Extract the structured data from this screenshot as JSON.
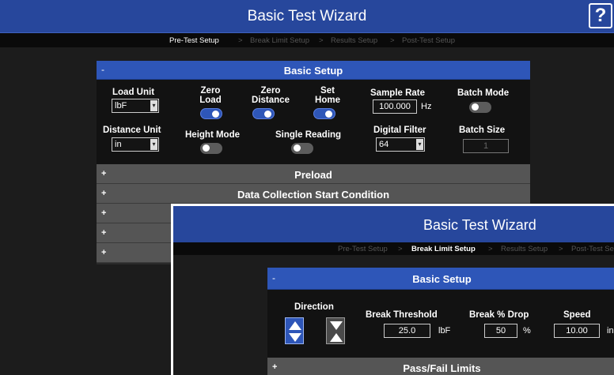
{
  "back_window": {
    "title": "Basic Test Wizard",
    "help_label": "?",
    "breadcrumbs": [
      "Pre-Test Setup",
      "Break Limit Setup",
      "Results Setup",
      "Post-Test Setup"
    ],
    "separator": ">",
    "basic_setup": {
      "toggle": "-",
      "title": "Basic Setup",
      "load_unit_label": "Load Unit",
      "load_unit_value": "lbF",
      "distance_unit_label": "Distance Unit",
      "distance_unit_value": "in",
      "zero_load_label": "Zero\nLoad",
      "zero_load_on": true,
      "zero_distance_label": "Zero\nDistance",
      "zero_distance_on": true,
      "set_home_label": "Set\nHome",
      "set_home_on": true,
      "height_mode_label": "Height Mode",
      "height_mode_on": false,
      "single_reading_label": "Single Reading",
      "single_reading_on": false,
      "sample_rate_label": "Sample Rate",
      "sample_rate_value": "100.000",
      "sample_rate_unit": "Hz",
      "digital_filter_label": "Digital Filter",
      "digital_filter_value": "64",
      "batch_mode_label": "Batch Mode",
      "batch_mode_on": false,
      "batch_size_label": "Batch Size",
      "batch_size_value": "1"
    },
    "collapsed_sections": [
      {
        "toggle": "+",
        "label": "Preload"
      },
      {
        "toggle": "+",
        "label": "Data Collection Start Condition"
      },
      {
        "toggle": "+",
        "label": ""
      },
      {
        "toggle": "+",
        "label": ""
      },
      {
        "toggle": "+",
        "label": ""
      }
    ]
  },
  "front_window": {
    "title": "Basic Test Wizard",
    "breadcrumbs": [
      "Pre-Test Setup",
      "Break Limit Setup",
      "Results Setup",
      "Post-Test Se"
    ],
    "separator": ">",
    "basic_setup": {
      "toggle": "-",
      "title": "Basic Setup",
      "direction_label": "Direction",
      "break_threshold_label": "Break Threshold",
      "break_threshold_value": "25.0",
      "break_threshold_unit": "lbF",
      "break_drop_label": "Break % Drop",
      "break_drop_value": "50",
      "break_drop_unit": "%",
      "speed_label": "Speed",
      "speed_value": "10.00",
      "speed_unit": "in"
    },
    "pass_fail": {
      "toggle": "+",
      "label": "Pass/Fail Limits"
    }
  },
  "colors": {
    "titlebar": "#27479c",
    "section_header": "#2e56b8",
    "collapsed_row": "#555555"
  }
}
